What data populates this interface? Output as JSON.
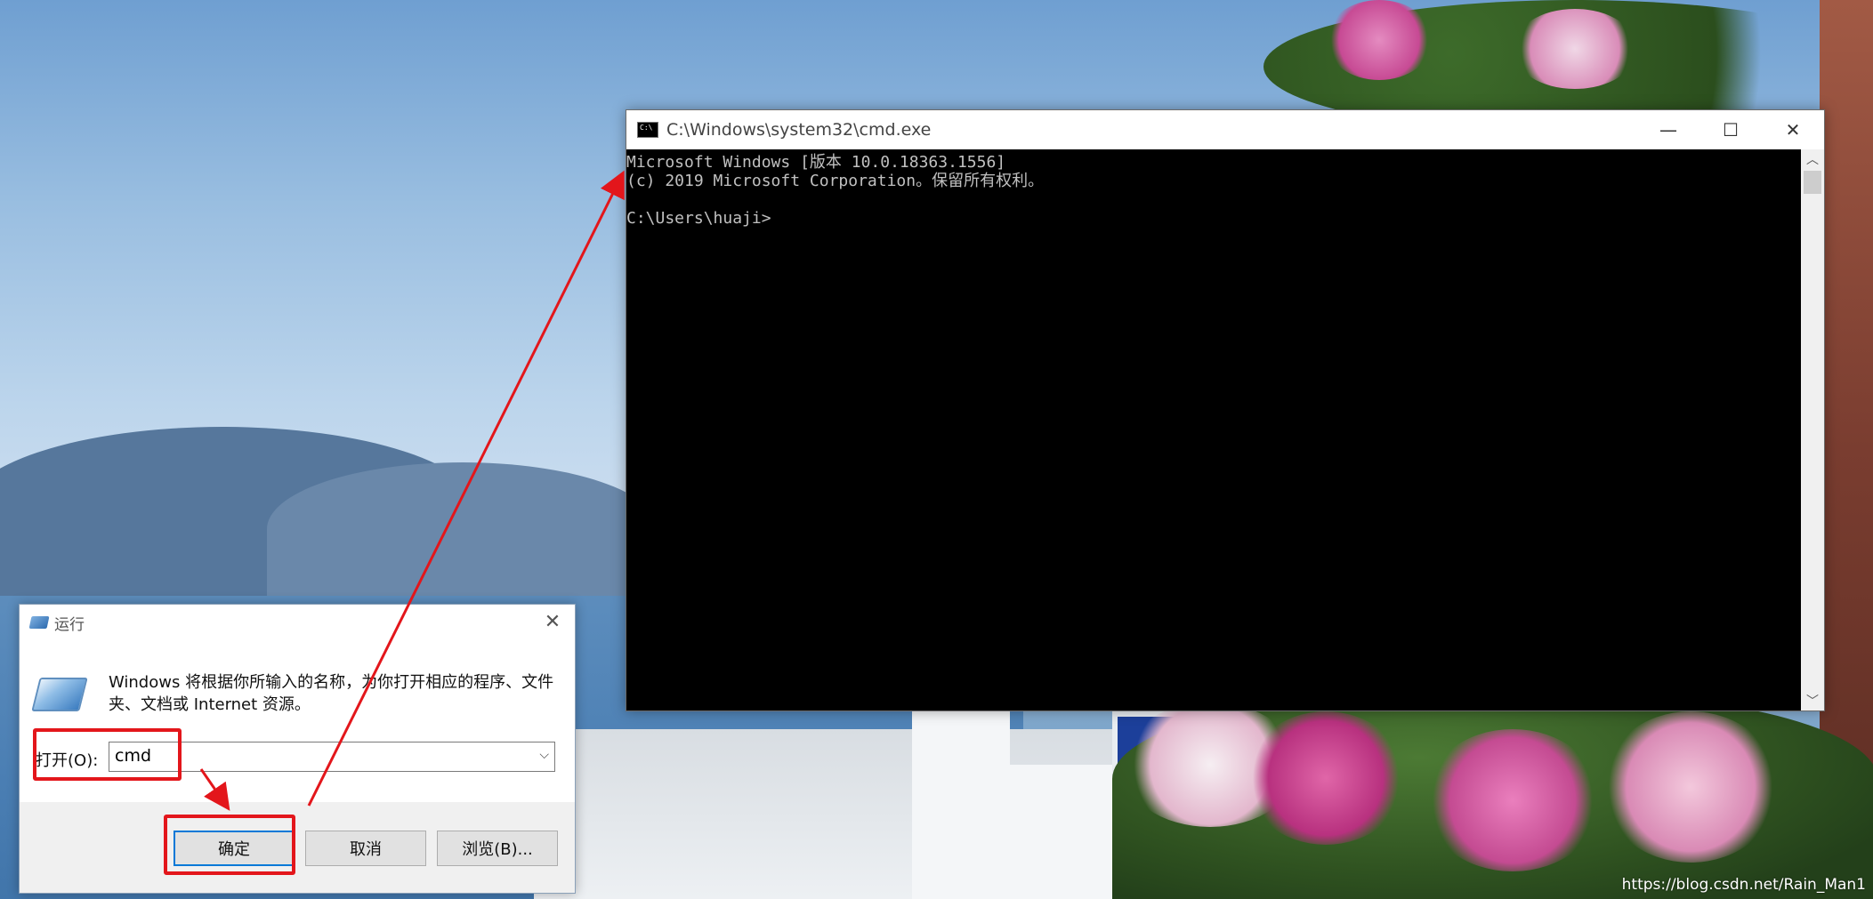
{
  "cmd_window": {
    "title": "C:\\Windows\\system32\\cmd.exe",
    "icon": "console-icon",
    "controls": {
      "minimize": "—",
      "maximize": "☐",
      "close": "✕"
    },
    "output": "Microsoft Windows [版本 10.0.18363.1556]\n(c) 2019 Microsoft Corporation。保留所有权利。\n\nC:\\Users\\huaji>"
  },
  "run_dialog": {
    "title": "运行",
    "close": "✕",
    "description": "Windows 将根据你所输入的名称，为你打开相应的程序、文件夹、文档或 Internet 资源。",
    "open_label": "打开(O):",
    "open_value": "cmd",
    "dropdown_glyph": "⌵",
    "buttons": {
      "ok": "确定",
      "cancel": "取消",
      "browse": "浏览(B)..."
    }
  },
  "annotation_color": "#e3161b",
  "watermark": "https://blog.csdn.net/Rain_Man1"
}
